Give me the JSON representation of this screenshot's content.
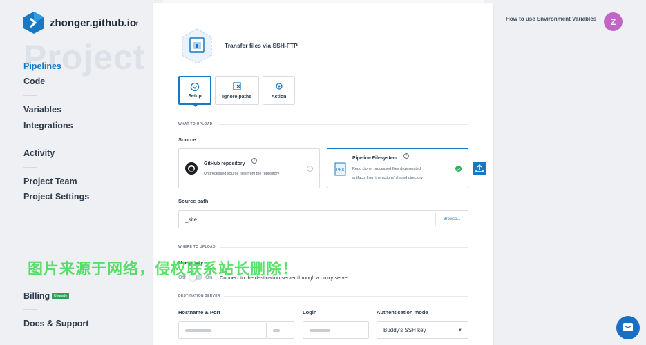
{
  "org": {
    "name": "zhonger.github.io"
  },
  "page": {
    "watermark_title": "Project"
  },
  "sidebar": {
    "items": [
      {
        "label": "Pipelines"
      },
      {
        "label": "Code"
      },
      {
        "label": "Variables"
      },
      {
        "label": "Integrations"
      },
      {
        "label": "Activity"
      },
      {
        "label": "Project Team"
      },
      {
        "label": "Project Settings"
      },
      {
        "label": "Billing"
      },
      {
        "label": "Docs & Support"
      }
    ],
    "upgrade_badge": "Upgrade"
  },
  "overlay_text": "图片来源于网络，侵权联系站长删除！",
  "header": {
    "help_link": "How to use Environment Variables",
    "avatar_initial": "Z"
  },
  "action": {
    "title": "Transfer files via SSH-FTP"
  },
  "tabs": [
    {
      "label": "Setup",
      "active": true
    },
    {
      "label": "Ignore paths",
      "active": false
    },
    {
      "label": "Action",
      "active": false
    }
  ],
  "sections": {
    "what_to_upload": "WHAT TO UPLOAD",
    "where_to_upload": "WHERE TO UPLOAD",
    "destination_server": "DESTINATION SERVER"
  },
  "source": {
    "label": "Source",
    "options": [
      {
        "title": "GitHub repository",
        "desc": "Unprocessed source files from the repository",
        "selected": false
      },
      {
        "title": "Pipeline Filesystem",
        "desc_line1": "Repo clone, processed files & generated",
        "desc_line2": "artifacts from the actions' shared directory",
        "selected": true,
        "icon_text": "PFS"
      }
    ]
  },
  "source_path": {
    "label": "Source path",
    "value": "_site",
    "browse_label": "Browse..."
  },
  "proxy": {
    "label": "Use proxy",
    "off_label": "Off",
    "on_label": "On",
    "enabled": false,
    "desc": "Connect to the destination server through a proxy server"
  },
  "destination": {
    "hostname_label": "Hostname & Port",
    "login_label": "Login",
    "auth_label": "Authentication mode",
    "auth_value": "Buddy's SSH key"
  },
  "colors": {
    "accent": "#1a78c2",
    "success": "#2fb15e",
    "avatar": "#c066c4",
    "badge": "#29a15a"
  }
}
